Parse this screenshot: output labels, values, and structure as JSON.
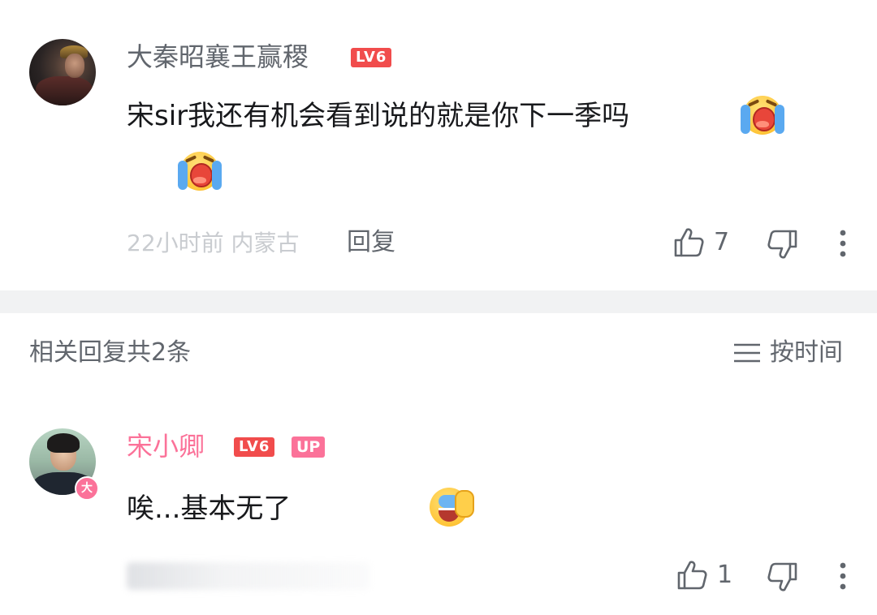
{
  "comment": {
    "username": "大秦昭襄王赢稷",
    "level_badge": "LV6",
    "text": "宋sir我还有机会看到说的就是你下一季吗",
    "emojis": [
      "cry-emoji",
      "cry-emoji"
    ],
    "time": "22小时前",
    "location": "内蒙古",
    "reply_label": "回复",
    "like_count": "7",
    "icons": [
      "thumbs-up-icon",
      "thumbs-down-icon",
      "more-icon"
    ]
  },
  "replies_section": {
    "title": "相关回复共2条",
    "sort_label": "按时间",
    "sort_icon": "menu-lines-icon"
  },
  "reply": {
    "username": "宋小卿",
    "level_badge": "LV6",
    "up_badge": "UP",
    "avatar_badge": "大",
    "text": "唉...基本无了",
    "emoji": "laugh-cry-emoji",
    "like_count": "1"
  },
  "colors": {
    "accent_pink": "#fb7299",
    "level_red": "#f14c4c",
    "secondary_text": "#61666d",
    "muted_text": "#c9ccd0",
    "divider": "#f1f2f3"
  }
}
